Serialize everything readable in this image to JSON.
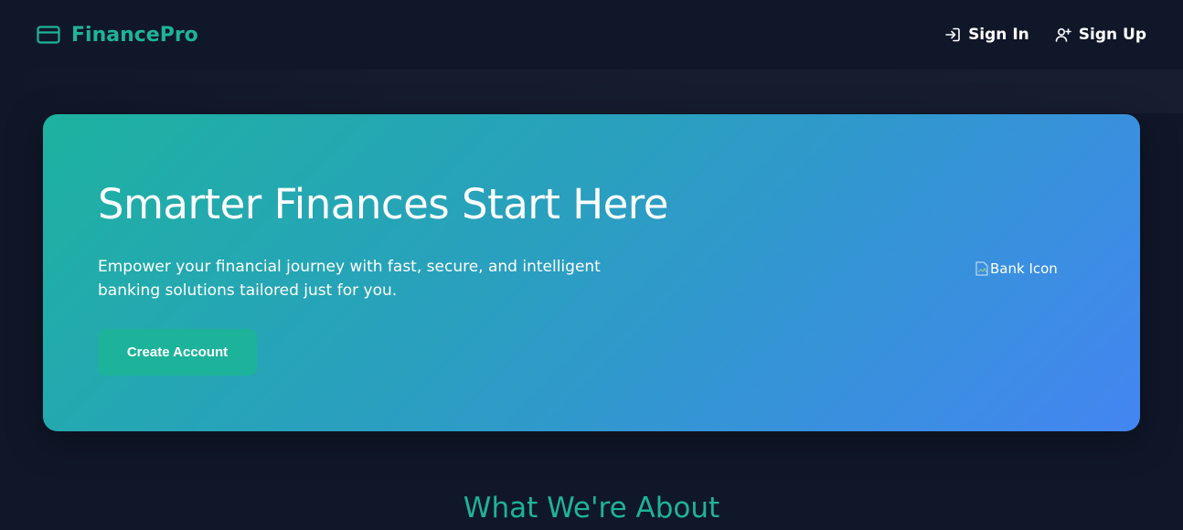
{
  "header": {
    "brand": "FinancePro",
    "brand_icon": "credit-card-icon",
    "nav": [
      {
        "label": "Sign In",
        "icon": "sign-in-icon"
      },
      {
        "label": "Sign Up",
        "icon": "user-plus-icon"
      }
    ]
  },
  "hero": {
    "title": "Smarter Finances Start Here",
    "description": "Empower your financial journey with fast, secure, and intelligent banking solutions tailored just for you.",
    "cta_label": "Create Account",
    "image_alt": "Bank Icon"
  },
  "section": {
    "title": "What We're About"
  },
  "colors": {
    "background": "#101729",
    "accent": "#1fb397",
    "hero_gradient_start": "#1db2a0",
    "hero_gradient_end": "#4485f2",
    "button": "#1cb39a"
  }
}
